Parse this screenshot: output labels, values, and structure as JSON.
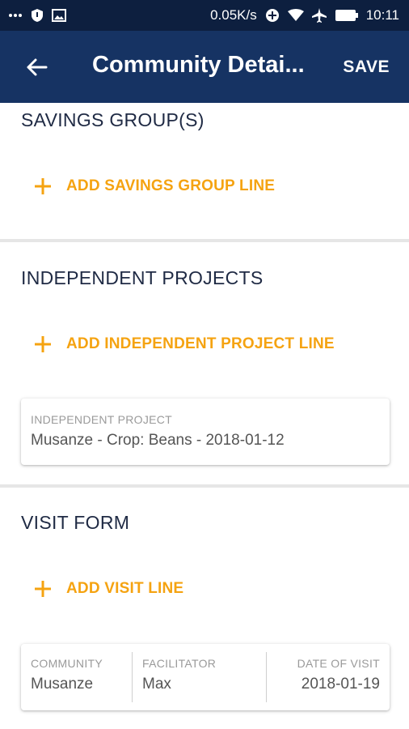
{
  "status_bar": {
    "left_icons": [
      "more-dots-icon",
      "shield-icon",
      "image-icon"
    ],
    "speed": "0.05K/s",
    "time": "10:11"
  },
  "app_bar": {
    "title": "Community Detai...",
    "save_label": "SAVE"
  },
  "sections": {
    "savings": {
      "title": "SAVINGS GROUP(S)",
      "add_label": "ADD SAVINGS GROUP LINE"
    },
    "projects": {
      "title": "INDEPENDENT PROJECTS",
      "add_label": "ADD INDEPENDENT PROJECT LINE",
      "card": {
        "label": "INDEPENDENT PROJECT",
        "value": "Musanze  - Crop: Beans - 2018-01-12"
      }
    },
    "visit": {
      "title": "VISIT FORM",
      "add_label": "ADD VISIT LINE",
      "card": {
        "columns": [
          {
            "label": "COMMUNITY",
            "value": "Musanze"
          },
          {
            "label": "FACILITATOR",
            "value": "Max"
          },
          {
            "label": "DATE OF VISIT",
            "value": "2018-01-19"
          }
        ]
      }
    }
  },
  "colors": {
    "status_bar": "#0d1f3f",
    "app_bar": "#163363",
    "accent": "#f5a311",
    "section_title": "#1f2a44"
  }
}
